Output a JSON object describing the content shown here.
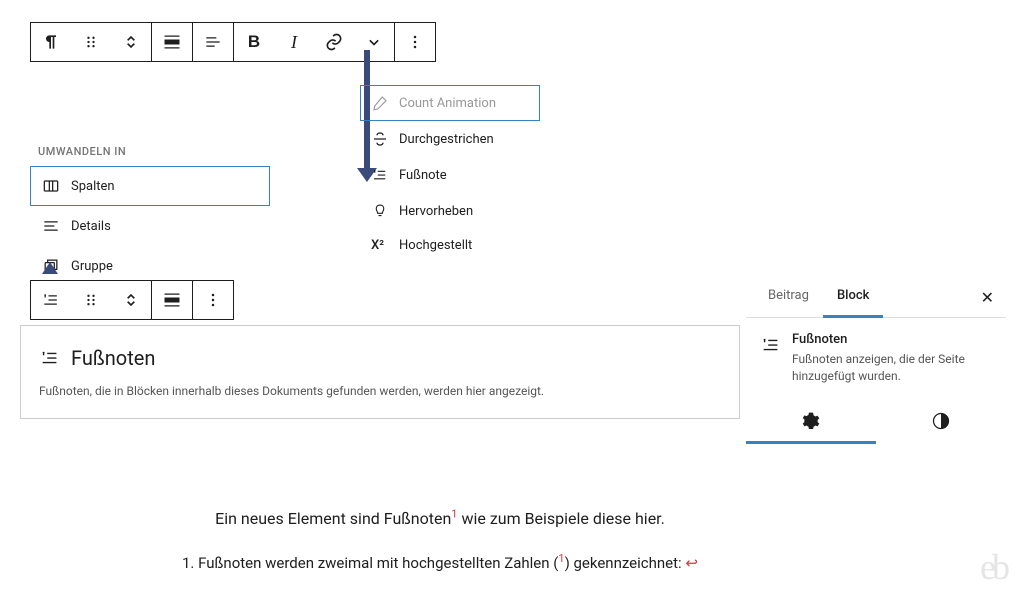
{
  "toolbar": {
    "para_icon": "paragraph",
    "drag_icon": "drag",
    "move_icon": "move",
    "align_icon": "align-wide",
    "justify_icon": "align-left",
    "bold_label": "B",
    "italic_label": "I",
    "link_icon": "link",
    "more_icon": "chevron-down",
    "options_icon": "dots-vertical"
  },
  "transform": {
    "title": "UMWANDELN IN",
    "items": [
      {
        "icon": "columns",
        "label": "Spalten"
      },
      {
        "icon": "details",
        "label": "Details"
      },
      {
        "icon": "group",
        "label": "Gruppe"
      }
    ]
  },
  "dropdown": {
    "items": [
      {
        "icon": "pencil",
        "label": "Count Animation"
      },
      {
        "icon": "strike",
        "label": "Durchgestrichen"
      },
      {
        "icon": "footnote",
        "label": "Fußnote"
      },
      {
        "icon": "highlight",
        "label": "Hervorheben"
      },
      {
        "icon": "super",
        "label": "Hochgestellt",
        "glyph": "X²"
      }
    ]
  },
  "block": {
    "title": "Fußnoten",
    "desc": "Fußnoten, die in Blöcken innerhalb dieses Dokuments gefunden werden, werden hier angezeigt."
  },
  "inspector": {
    "tab_post": "Beitrag",
    "tab_block": "Block",
    "name": "Fußnoten",
    "desc": "Fußnoten anzeigen, die der Seite hinzugefügt wurden."
  },
  "footer": {
    "line1_a": "Ein neues Element sind Fußnoten",
    "line1_sup": "1",
    "line1_b": " wie zum Beispiele diese hier.",
    "line2_a": "1. Fußnoten werden zweimal mit hochgestellten Zahlen (",
    "line2_sup": "1",
    "line2_b": ") gekennzeichnet: ",
    "enter": "↩"
  },
  "watermark": "eb"
}
